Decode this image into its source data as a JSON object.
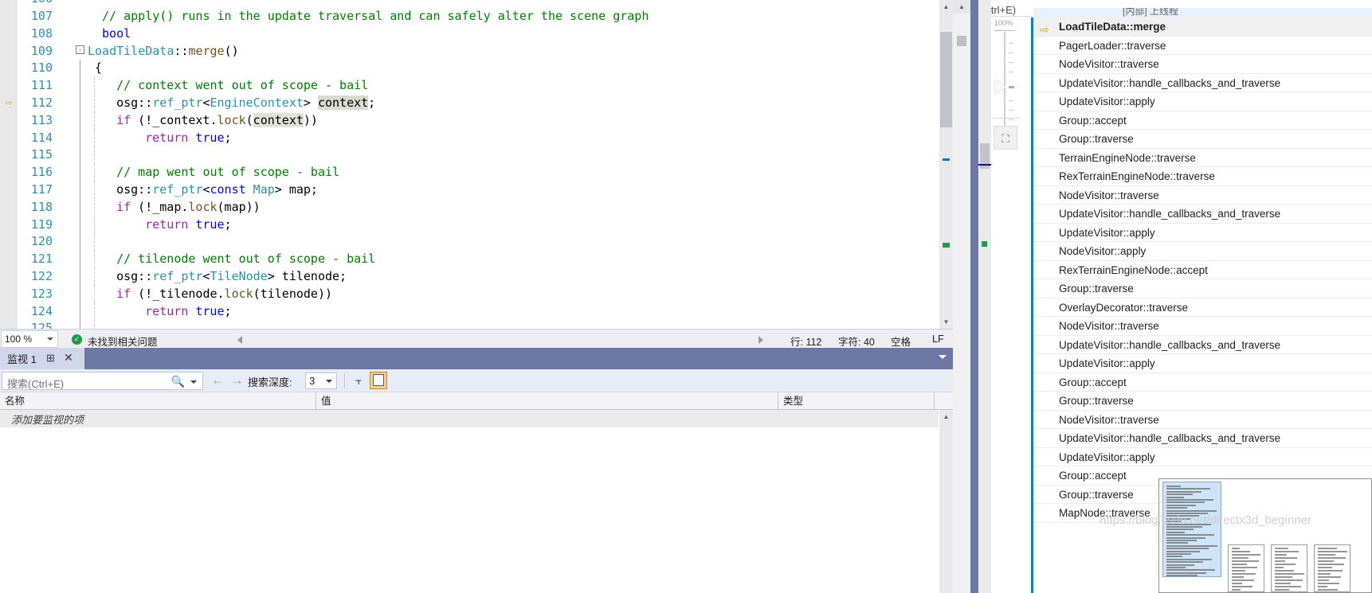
{
  "editor": {
    "zoom_level": "100 %",
    "issue_status": "未找到相关问题",
    "line_label": "行: 112",
    "char_label": "字符: 40",
    "space_label": "空格",
    "eol_label": "LF",
    "cursor_line": 112,
    "cursor_char": 40,
    "lines": [
      {
        "num": "106",
        "clipped": true,
        "tokens": []
      },
      {
        "num": "107",
        "indent": 2,
        "tokens": [
          {
            "t": "// apply() runs in the update traversal and can safely alter the scene graph",
            "c": "t-com"
          }
        ]
      },
      {
        "num": "108",
        "indent": 2,
        "tokens": [
          {
            "t": "bool",
            "c": "t-kw"
          }
        ]
      },
      {
        "num": "109",
        "outline": "-",
        "indent": 0,
        "tokens": [
          {
            "t": "LoadTileData",
            "c": "t-type"
          },
          {
            "t": "::",
            "c": "t-pln"
          },
          {
            "t": "merge",
            "c": "t-fn"
          },
          {
            "t": "()",
            "c": "t-pln"
          }
        ]
      },
      {
        "num": "110",
        "bar": true,
        "indent": 1,
        "tokens": [
          {
            "t": "{",
            "c": "t-pln"
          }
        ]
      },
      {
        "num": "111",
        "bar": true,
        "dash": true,
        "indent": 4,
        "tokens": [
          {
            "t": "// context went out of scope - bail",
            "c": "t-com"
          }
        ]
      },
      {
        "num": "112",
        "bar": true,
        "dash": true,
        "indent": 4,
        "current": true,
        "tokens": [
          {
            "t": "osg",
            "c": "t-pln"
          },
          {
            "t": "::",
            "c": "t-pln"
          },
          {
            "t": "ref_ptr",
            "c": "t-type"
          },
          {
            "t": "<",
            "c": "t-pln"
          },
          {
            "t": "EngineContext",
            "c": "t-type"
          },
          {
            "t": "> ",
            "c": "t-pln"
          },
          {
            "t": "context",
            "c": "t-pln t-hl"
          },
          {
            "t": ";",
            "c": "t-pln"
          }
        ]
      },
      {
        "num": "113",
        "bar": true,
        "dash": true,
        "indent": 4,
        "tokens": [
          {
            "t": "if",
            "c": "t-kw2"
          },
          {
            "t": " (!_context.",
            "c": "t-pln"
          },
          {
            "t": "lock",
            "c": "t-fn"
          },
          {
            "t": "(",
            "c": "t-pln"
          },
          {
            "t": "context",
            "c": "t-pln t-hl2"
          },
          {
            "t": "))",
            "c": "t-pln"
          }
        ]
      },
      {
        "num": "114",
        "bar": true,
        "dash": true,
        "indent": 8,
        "tokens": [
          {
            "t": "return",
            "c": "t-kw2"
          },
          {
            "t": " ",
            "c": "t-pln"
          },
          {
            "t": "true",
            "c": "t-kw"
          },
          {
            "t": ";",
            "c": "t-pln"
          }
        ]
      },
      {
        "num": "115",
        "bar": true,
        "dash": true,
        "indent": 4,
        "tokens": []
      },
      {
        "num": "116",
        "bar": true,
        "dash": true,
        "indent": 4,
        "tokens": [
          {
            "t": "// map went out of scope - bail",
            "c": "t-com"
          }
        ]
      },
      {
        "num": "117",
        "bar": true,
        "dash": true,
        "indent": 4,
        "tokens": [
          {
            "t": "osg::",
            "c": "t-pln"
          },
          {
            "t": "ref_ptr",
            "c": "t-type"
          },
          {
            "t": "<",
            "c": "t-pln"
          },
          {
            "t": "const",
            "c": "t-kw"
          },
          {
            "t": " ",
            "c": "t-pln"
          },
          {
            "t": "Map",
            "c": "t-type"
          },
          {
            "t": "> map;",
            "c": "t-pln"
          }
        ]
      },
      {
        "num": "118",
        "bar": true,
        "dash": true,
        "indent": 4,
        "tokens": [
          {
            "t": "if",
            "c": "t-kw2"
          },
          {
            "t": " (!_map.",
            "c": "t-pln"
          },
          {
            "t": "lock",
            "c": "t-fn"
          },
          {
            "t": "(map))",
            "c": "t-pln"
          }
        ]
      },
      {
        "num": "119",
        "bar": true,
        "dash": true,
        "indent": 8,
        "tokens": [
          {
            "t": "return",
            "c": "t-kw2"
          },
          {
            "t": " ",
            "c": "t-pln"
          },
          {
            "t": "true",
            "c": "t-kw"
          },
          {
            "t": ";",
            "c": "t-pln"
          }
        ]
      },
      {
        "num": "120",
        "bar": true,
        "dash": true,
        "indent": 4,
        "tokens": []
      },
      {
        "num": "121",
        "bar": true,
        "dash": true,
        "indent": 4,
        "tokens": [
          {
            "t": "// tilenode went out of scope - bail",
            "c": "t-com"
          }
        ]
      },
      {
        "num": "122",
        "bar": true,
        "dash": true,
        "indent": 4,
        "tokens": [
          {
            "t": "osg::",
            "c": "t-pln"
          },
          {
            "t": "ref_ptr",
            "c": "t-type"
          },
          {
            "t": "<",
            "c": "t-pln"
          },
          {
            "t": "TileNode",
            "c": "t-type"
          },
          {
            "t": "> tilenode;",
            "c": "t-pln"
          }
        ]
      },
      {
        "num": "123",
        "bar": true,
        "dash": true,
        "indent": 4,
        "tokens": [
          {
            "t": "if",
            "c": "t-kw2"
          },
          {
            "t": " (!_tilenode.",
            "c": "t-pln"
          },
          {
            "t": "lock",
            "c": "t-fn"
          },
          {
            "t": "(tilenode))",
            "c": "t-pln"
          }
        ]
      },
      {
        "num": "124",
        "bar": true,
        "dash": true,
        "indent": 8,
        "tokens": [
          {
            "t": "return",
            "c": "t-kw2"
          },
          {
            "t": " ",
            "c": "t-pln"
          },
          {
            "t": "true",
            "c": "t-kw"
          },
          {
            "t": ";",
            "c": "t-pln"
          }
        ]
      },
      {
        "num": "125",
        "bar": true,
        "dash": true,
        "indent": 4,
        "tokens": []
      }
    ]
  },
  "watch": {
    "tab_label": "监视 1",
    "pin_icon": "pin-icon",
    "close_icon": "close-icon",
    "search_placeholder": "搜索(Ctrl+E)",
    "depth_label": "搜索深度:",
    "depth_value": "3",
    "columns": [
      "名称",
      "值",
      "类型"
    ],
    "empty_row_text": "添加要监视的项",
    "rows": []
  },
  "callstack": {
    "search_placeholder": "搜索(Ctrl+E)",
    "zoom_label": "100%",
    "clipped_header": "[内部] 上线程",
    "frames": [
      {
        "name": "LoadTileData::merge",
        "current": true
      },
      {
        "name": "PagerLoader::traverse",
        "current": false
      },
      {
        "name": "NodeVisitor::traverse",
        "current": false
      },
      {
        "name": "UpdateVisitor::handle_callbacks_and_traverse",
        "current": false
      },
      {
        "name": "UpdateVisitor::apply",
        "current": false
      },
      {
        "name": "Group::accept",
        "current": false
      },
      {
        "name": "Group::traverse",
        "current": false
      },
      {
        "name": "TerrainEngineNode::traverse",
        "current": false
      },
      {
        "name": "RexTerrainEngineNode::traverse",
        "current": false
      },
      {
        "name": "NodeVisitor::traverse",
        "current": false
      },
      {
        "name": "UpdateVisitor::handle_callbacks_and_traverse",
        "current": false
      },
      {
        "name": "UpdateVisitor::apply",
        "current": false
      },
      {
        "name": "NodeVisitor::apply",
        "current": false
      },
      {
        "name": "RexTerrainEngineNode::accept",
        "current": false
      },
      {
        "name": "Group::traverse",
        "current": false
      },
      {
        "name": "OverlayDecorator::traverse",
        "current": false
      },
      {
        "name": "NodeVisitor::traverse",
        "current": false
      },
      {
        "name": "UpdateVisitor::handle_callbacks_and_traverse",
        "current": false
      },
      {
        "name": "UpdateVisitor::apply",
        "current": false
      },
      {
        "name": "Group::accept",
        "current": false
      },
      {
        "name": "Group::traverse",
        "current": false
      },
      {
        "name": "NodeVisitor::traverse",
        "current": false
      },
      {
        "name": "UpdateVisitor::handle_callbacks_and_traverse",
        "current": false
      },
      {
        "name": "UpdateVisitor::apply",
        "current": false
      },
      {
        "name": "Group::accept",
        "current": false
      },
      {
        "name": "Group::traverse",
        "current": false
      },
      {
        "name": "MapNode::traverse",
        "current": false
      }
    ]
  },
  "watermark": "https://blog.csdn.net/directx3d_beginner",
  "colors": {
    "accent_blue": "#0b7fd4",
    "tabstrip": "#6d79a4",
    "current_arrow": "#e9a700",
    "ok_green": "#1f9b49",
    "comment_green": "#008000",
    "type_teal": "#2b91af"
  }
}
